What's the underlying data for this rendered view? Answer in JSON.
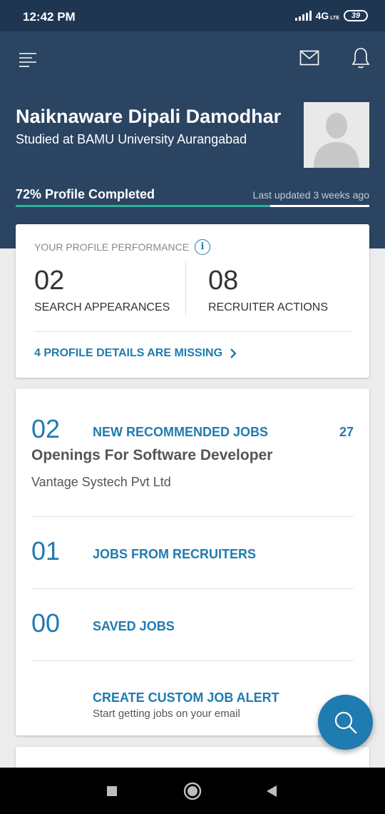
{
  "status_bar": {
    "time": "12:42 PM",
    "network": "4G",
    "network_sub": "LTE",
    "battery": "39"
  },
  "header": {
    "name": "Naiknaware Dipali Damodhar",
    "studied": "Studied at BAMU University Aurangabad",
    "profile_completion_label": "72% Profile Completed",
    "profile_completion_fraction": 0.72,
    "last_updated": "Last updated 3 weeks ago"
  },
  "performance": {
    "title": "YOUR PROFILE PERFORMANCE",
    "info_icon": "i",
    "search_appearances": {
      "value": "02",
      "label": "SEARCH APPEARANCES"
    },
    "recruiter_actions": {
      "value": "08",
      "label": "RECRUITER ACTIONS"
    },
    "missing_link": "4 PROFILE DETAILS ARE MISSING"
  },
  "jobs": {
    "recommended": {
      "count": "02",
      "label": "NEW RECOMMENDED JOBS",
      "right_count": "27"
    },
    "opening_title": "Openings For Software Developer",
    "company": "Vantage Systech Pvt Ltd",
    "recruiters": {
      "count": "01",
      "label": "JOBS FROM RECRUITERS"
    },
    "saved": {
      "count": "00",
      "label": "SAVED JOBS"
    },
    "alert": {
      "title": "CREATE CUSTOM JOB ALERT",
      "subtitle": "Start getting jobs on your email"
    }
  },
  "icons": {
    "menu": "menu-icon",
    "mail": "mail-icon",
    "bell": "bell-icon",
    "search_fab": "search-icon",
    "nav_recent": "square-icon",
    "nav_home": "circle-icon",
    "nav_back": "back-triangle-icon"
  },
  "colors": {
    "header_bg": "#2b4462",
    "status_bg": "#1f3653",
    "accent_blue": "#1f7bb0",
    "progress_green": "#2bb39a"
  }
}
